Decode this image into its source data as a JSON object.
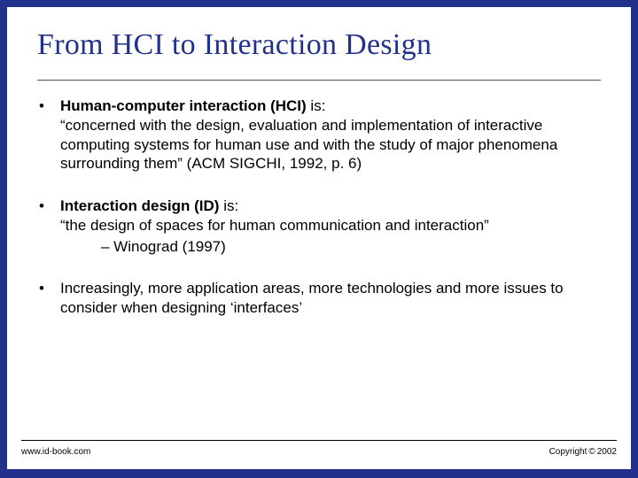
{
  "title": "From HCI to Interaction Design",
  "bullets": [
    {
      "lead": "Human-computer interaction (HCI)",
      "lead_tail": " is:",
      "body": "“concerned with the design, evaluation and implementation of interactive computing systems for human use and with the study of major phenomena surrounding them” (ACM SIGCHI, 1992, p. 6)",
      "sub": ""
    },
    {
      "lead": "Interaction design (ID)",
      "lead_tail": " is:",
      "body": "“the design of spaces for human communication and interaction”",
      "sub": "– Winograd (1997)"
    },
    {
      "lead": "",
      "lead_tail": "",
      "body": "Increasingly, more application areas, more technologies and more issues to consider when designing ‘interfaces’",
      "sub": ""
    }
  ],
  "footer": {
    "left": "www.id-book.com",
    "right_prefix": "Copyright",
    "right_symbol": "©",
    "right_year": "2002"
  }
}
